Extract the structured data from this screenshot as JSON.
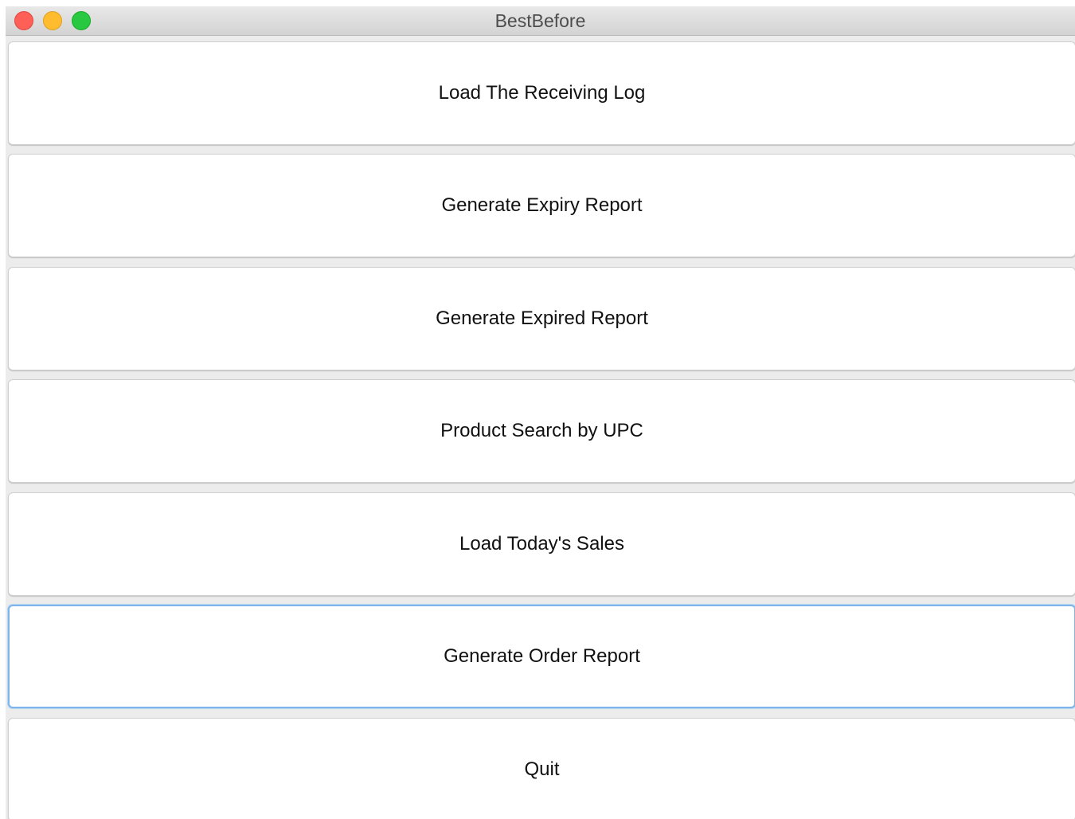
{
  "window": {
    "title": "BestBefore"
  },
  "buttons": [
    {
      "label": "Load The Receiving Log"
    },
    {
      "label": "Generate Expiry Report"
    },
    {
      "label": "Generate Expired Report"
    },
    {
      "label": "Product Search by UPC"
    },
    {
      "label": "Load Today's Sales"
    },
    {
      "label": "Generate Order Report",
      "focused": true
    },
    {
      "label": "Quit"
    }
  ],
  "colors": {
    "close": "#fe5f57",
    "minimize": "#febc2e",
    "zoom": "#28c840",
    "focus_ring": "#7eb4ea"
  },
  "icons": {
    "close": "close-traffic-light-icon",
    "minimize": "minimize-traffic-light-icon",
    "zoom": "zoom-traffic-light-icon"
  }
}
